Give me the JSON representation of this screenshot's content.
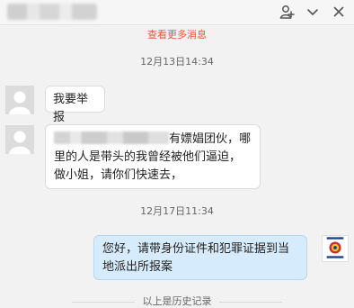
{
  "titlebar": {
    "contact_name": "",
    "icons": {
      "add_user": "add-user-icon",
      "more": "chevron-down-icon",
      "close": "close-icon"
    }
  },
  "chat": {
    "more_messages_link": "查看更多消息",
    "link_color": "#e8573c",
    "timestamps": [
      "12月13日14:34",
      "12月17日11:34"
    ],
    "messages": [
      {
        "side": "left",
        "text": "我要举报"
      },
      {
        "side": "left",
        "text_after_redaction": "有嫖娼团伙，哪里的人是带头的我曾经被他们逼迫，做小姐，请你们快速去，",
        "redacted": true
      },
      {
        "side": "right",
        "text": "您好，请带身份证件和犯罪证据到当地派出所报案",
        "bubble_color": "#d6ebfb"
      }
    ],
    "history_label": "以上是历史记录"
  }
}
